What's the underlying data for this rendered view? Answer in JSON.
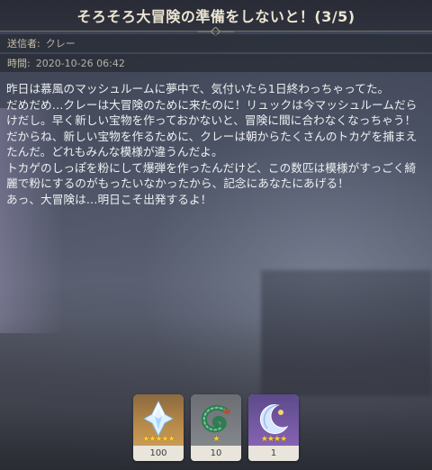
{
  "mail": {
    "title": "そろそろ大冒険の準備をしないと！(3/5)",
    "sender_label": "送信者:",
    "sender_value": "クレー",
    "time_label": "時間:",
    "time_value": "2020-10-26 06:42",
    "body": [
      "昨日は慕風のマッシュルームに夢中で、気付いたら1日終わっちゃってた。",
      "だめだめ…クレーは大冒険のために来たのに！リュックは今マッシュルームだらけだし。早く新しい宝物を作っておかないと、冒険に間に合わなくなっちゃう！",
      "だからね、新しい宝物を作るために、クレーは朝からたくさんのトカゲを捕まえたんだ。どれもみんな模様が違うんだよ。",
      "トカゲのしっぽを粉にして爆弾を作ったんだけど、この数匹は模様がすっごく綺麗で粉にするのがもったいなかったから、記念にあなたにあげる！",
      "あっ、大冒険は…明日こそ出発するよ！"
    ]
  },
  "attachments": [
    {
      "name": "primogem-icon",
      "count": "100",
      "stars": "★★★★★",
      "rarity": 5
    },
    {
      "name": "lizard-tail-icon",
      "count": "10",
      "stars": "★",
      "rarity": 1
    },
    {
      "name": "crescent-moon-item-icon",
      "count": "1",
      "stars": "★★★★",
      "rarity": 4
    }
  ]
}
